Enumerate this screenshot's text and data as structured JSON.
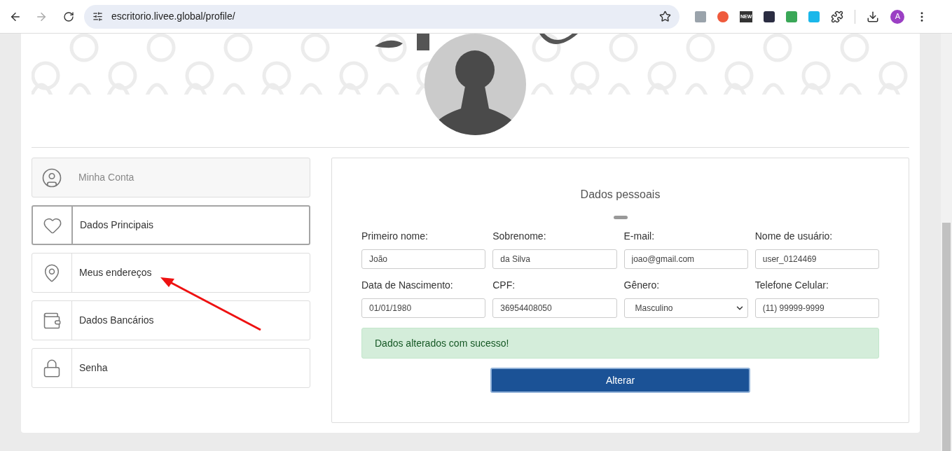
{
  "browser": {
    "url": "escritorio.livee.global/profile/",
    "extension_badge": "NEW",
    "profile_initial": "A"
  },
  "menu": [
    {
      "kind": "header",
      "label": "Minha Conta",
      "selected": false
    },
    {
      "kind": "item",
      "label": "Dados Principais",
      "selected": true
    },
    {
      "kind": "item",
      "label": "Meus endereços",
      "selected": false
    },
    {
      "kind": "item",
      "label": "Dados Bancários",
      "selected": false
    },
    {
      "kind": "item",
      "label": "Senha",
      "selected": false
    }
  ],
  "form": {
    "title": "Dados pessoais",
    "fields": [
      {
        "kind": "input",
        "label": "Primeiro nome:",
        "value": "João"
      },
      {
        "kind": "input",
        "label": "Sobrenome:",
        "value": "da Silva"
      },
      {
        "kind": "input",
        "label": "E-mail:",
        "value": "joao@gmail.com"
      },
      {
        "kind": "input",
        "label": "Nome de usuário:",
        "value": "user_0124469"
      },
      {
        "kind": "input",
        "label": "Data de Nascimento:",
        "value": "01/01/1980"
      },
      {
        "kind": "input",
        "label": "CPF:",
        "value": "36954408050"
      },
      {
        "kind": "select",
        "label": "Gênero:",
        "value": "Masculino"
      },
      {
        "kind": "input",
        "label": "Telefone Celular:",
        "value": "(11) 99999-9999"
      }
    ],
    "alert": "Dados alterados com sucesso!",
    "submit": "Alterar"
  }
}
